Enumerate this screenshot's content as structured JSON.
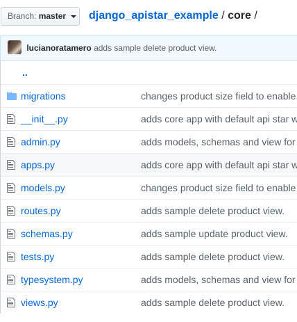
{
  "branch": {
    "label": "Branch:",
    "value": "master"
  },
  "breadcrumb": {
    "repo": "django_apistar_example",
    "separator": "/",
    "current": "core"
  },
  "commit": {
    "author": "lucianoratamero",
    "message": "adds sample delete product view."
  },
  "parent_link": "..",
  "files": [
    {
      "name": "migrations",
      "type": "folder",
      "message": "changes product size field to enable"
    },
    {
      "name": "__init__.py",
      "type": "file",
      "message": "adds core app with default api star w"
    },
    {
      "name": "admin.py",
      "type": "file",
      "message": "adds models, schemas and view for"
    },
    {
      "name": "apps.py",
      "type": "file",
      "message": "adds core app with default api star w"
    },
    {
      "name": "models.py",
      "type": "file",
      "message": "changes product size field to enable"
    },
    {
      "name": "routes.py",
      "type": "file",
      "message": "adds sample delete product view."
    },
    {
      "name": "schemas.py",
      "type": "file",
      "message": "adds sample update product view."
    },
    {
      "name": "tests.py",
      "type": "file",
      "message": "adds sample delete product view."
    },
    {
      "name": "typesystem.py",
      "type": "file",
      "message": "adds models, schemas and view for"
    },
    {
      "name": "views.py",
      "type": "file",
      "message": "adds sample delete product view."
    }
  ],
  "colors": {
    "link": "#0366d6",
    "muted": "#586069",
    "icon": "#6a737d",
    "folder": "#79b8ff",
    "commit_bg": "#f1f8ff"
  }
}
